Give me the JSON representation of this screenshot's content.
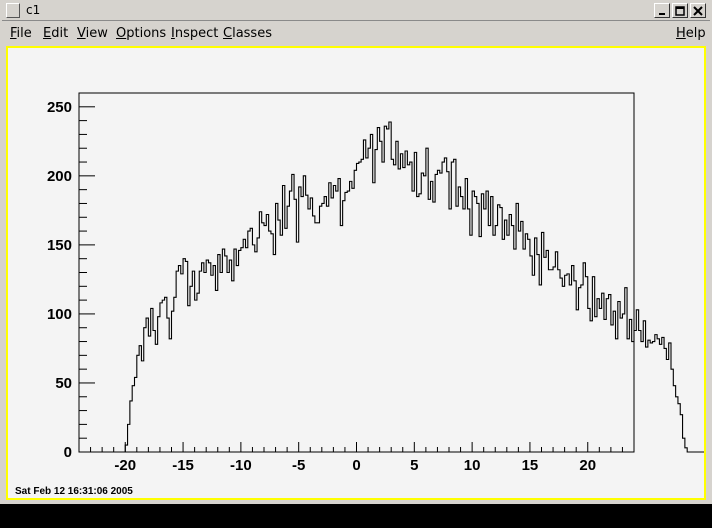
{
  "window": {
    "title": "c1"
  },
  "menubar": {
    "items": [
      "File",
      "Edit",
      "View",
      "Options",
      "Inspect",
      "Classes"
    ],
    "help": "Help"
  },
  "canvas": {
    "datestamp": "Sat Feb 12 16:31:06 2005",
    "colors": {
      "frame": "#ffff00",
      "background": "#f4f4f4",
      "line": "#000000"
    }
  },
  "chart_data": {
    "type": "histogram",
    "title": "",
    "xlabel": "",
    "ylabel": "",
    "xlim": [
      -24,
      24
    ],
    "ylim": [
      0,
      260
    ],
    "xticks": [
      -20,
      -15,
      -10,
      -5,
      0,
      5,
      10,
      15,
      20
    ],
    "yticks": [
      0,
      50,
      100,
      150,
      200,
      250
    ],
    "xtick_labels": [
      "-20",
      "-15",
      "-10",
      "-5",
      "0",
      "5",
      "10",
      "15",
      "20"
    ],
    "ytick_labels": [
      "0",
      "50",
      "100",
      "150",
      "200",
      "250"
    ],
    "grid": false,
    "bin_start": -20,
    "bin_width": 0.2,
    "values": [
      5,
      20,
      37,
      48,
      54,
      70,
      77,
      66,
      90,
      97,
      84,
      104,
      88,
      78,
      98,
      108,
      110,
      112,
      97,
      82,
      102,
      112,
      131,
      135,
      129,
      140,
      138,
      106,
      120,
      131,
      110,
      115,
      131,
      137,
      130,
      139,
      137,
      128,
      135,
      117,
      143,
      130,
      147,
      142,
      130,
      139,
      124,
      147,
      135,
      146,
      148,
      154,
      148,
      160,
      162,
      150,
      145,
      155,
      174,
      166,
      164,
      172,
      160,
      158,
      143,
      180,
      168,
      157,
      193,
      162,
      178,
      189,
      201,
      183,
      152,
      192,
      185,
      200,
      186,
      176,
      184,
      171,
      166,
      166,
      178,
      180,
      185,
      178,
      195,
      184,
      193,
      189,
      198,
      164,
      182,
      188,
      189,
      196,
      191,
      204,
      209,
      210,
      212,
      226,
      213,
      220,
      230,
      195,
      219,
      235,
      225,
      210,
      236,
      234,
      239,
      212,
      208,
      225,
      205,
      216,
      206,
      218,
      208,
      210,
      189,
      217,
      185,
      187,
      202,
      200,
      220,
      183,
      196,
      181,
      201,
      204,
      202,
      210,
      213,
      203,
      176,
      210,
      212,
      178,
      192,
      185,
      176,
      198,
      176,
      157,
      189,
      185,
      180,
      156,
      187,
      176,
      189,
      164,
      185,
      157,
      164,
      179,
      177,
      154,
      168,
      157,
      172,
      164,
      147,
      180,
      160,
      167,
      147,
      158,
      154,
      142,
      128,
      155,
      143,
      121,
      159,
      141,
      146,
      132,
      132,
      134,
      145,
      132,
      126,
      120,
      128,
      129,
      121,
      135,
      124,
      103,
      119,
      121,
      137,
      127,
      104,
      95,
      127,
      98,
      111,
      104,
      115,
      96,
      111,
      114,
      92,
      102,
      82,
      109,
      97,
      100,
      119,
      82,
      96,
      80,
      88,
      103,
      88,
      80,
      95,
      76,
      81,
      79,
      80,
      85,
      82,
      78,
      83,
      75,
      67,
      79,
      60,
      48,
      40,
      35,
      27,
      10,
      3,
      0,
      0,
      0,
      0,
      0,
      0,
      0,
      0,
      0,
      0,
      0,
      0,
      0,
      0,
      0,
      0,
      0
    ]
  }
}
